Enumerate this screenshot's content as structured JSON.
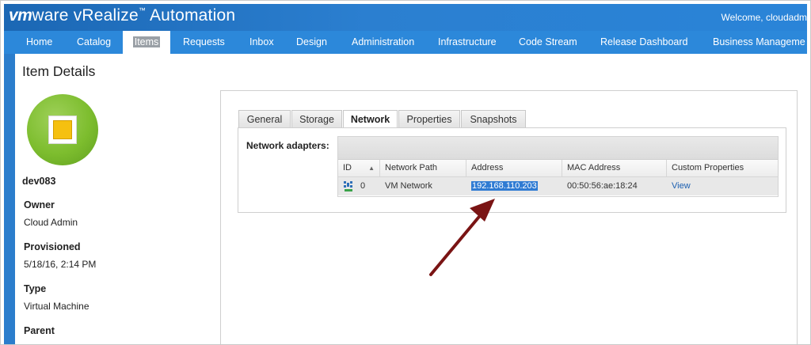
{
  "header": {
    "logo_vm": "vm",
    "logo_ware": "ware",
    "logo_product": "vRealize",
    "logo_tm": "™",
    "logo_suffix": "Automation",
    "welcome": "Welcome, cloudadm"
  },
  "nav": {
    "items": [
      {
        "label": "Home"
      },
      {
        "label": "Catalog"
      },
      {
        "label": "Items",
        "active": true
      },
      {
        "label": "Requests"
      },
      {
        "label": "Inbox"
      },
      {
        "label": "Design"
      },
      {
        "label": "Administration"
      },
      {
        "label": "Infrastructure"
      },
      {
        "label": "Code Stream"
      },
      {
        "label": "Release Dashboard"
      },
      {
        "label": "Business Manageme"
      }
    ]
  },
  "sidebar": {
    "title": "Item Details",
    "vm_name": "dev083",
    "owner_label": "Owner",
    "owner_value": "Cloud Admin",
    "provisioned_label": "Provisioned",
    "provisioned_value": "5/18/16, 2:14 PM",
    "type_label": "Type",
    "type_value": "Virtual Machine",
    "parent_label": "Parent"
  },
  "tabs": [
    {
      "label": "General"
    },
    {
      "label": "Storage"
    },
    {
      "label": "Network",
      "active": true
    },
    {
      "label": "Properties"
    },
    {
      "label": "Snapshots"
    }
  ],
  "network": {
    "label": "Network adapters:",
    "columns": [
      "ID",
      "Network Path",
      "Address",
      "MAC Address",
      "Custom Properties"
    ],
    "rows": [
      {
        "id": "0",
        "network_path": "VM Network",
        "address": "192.168.110.203",
        "mac": "00:50:56:ae:18:24",
        "custom": "View"
      }
    ]
  },
  "colors": {
    "nav_blue": "#2c88da",
    "header_blue": "#1b67b4",
    "selection_blue": "#2f7bd3",
    "arrow_red": "#8b1a1a"
  }
}
